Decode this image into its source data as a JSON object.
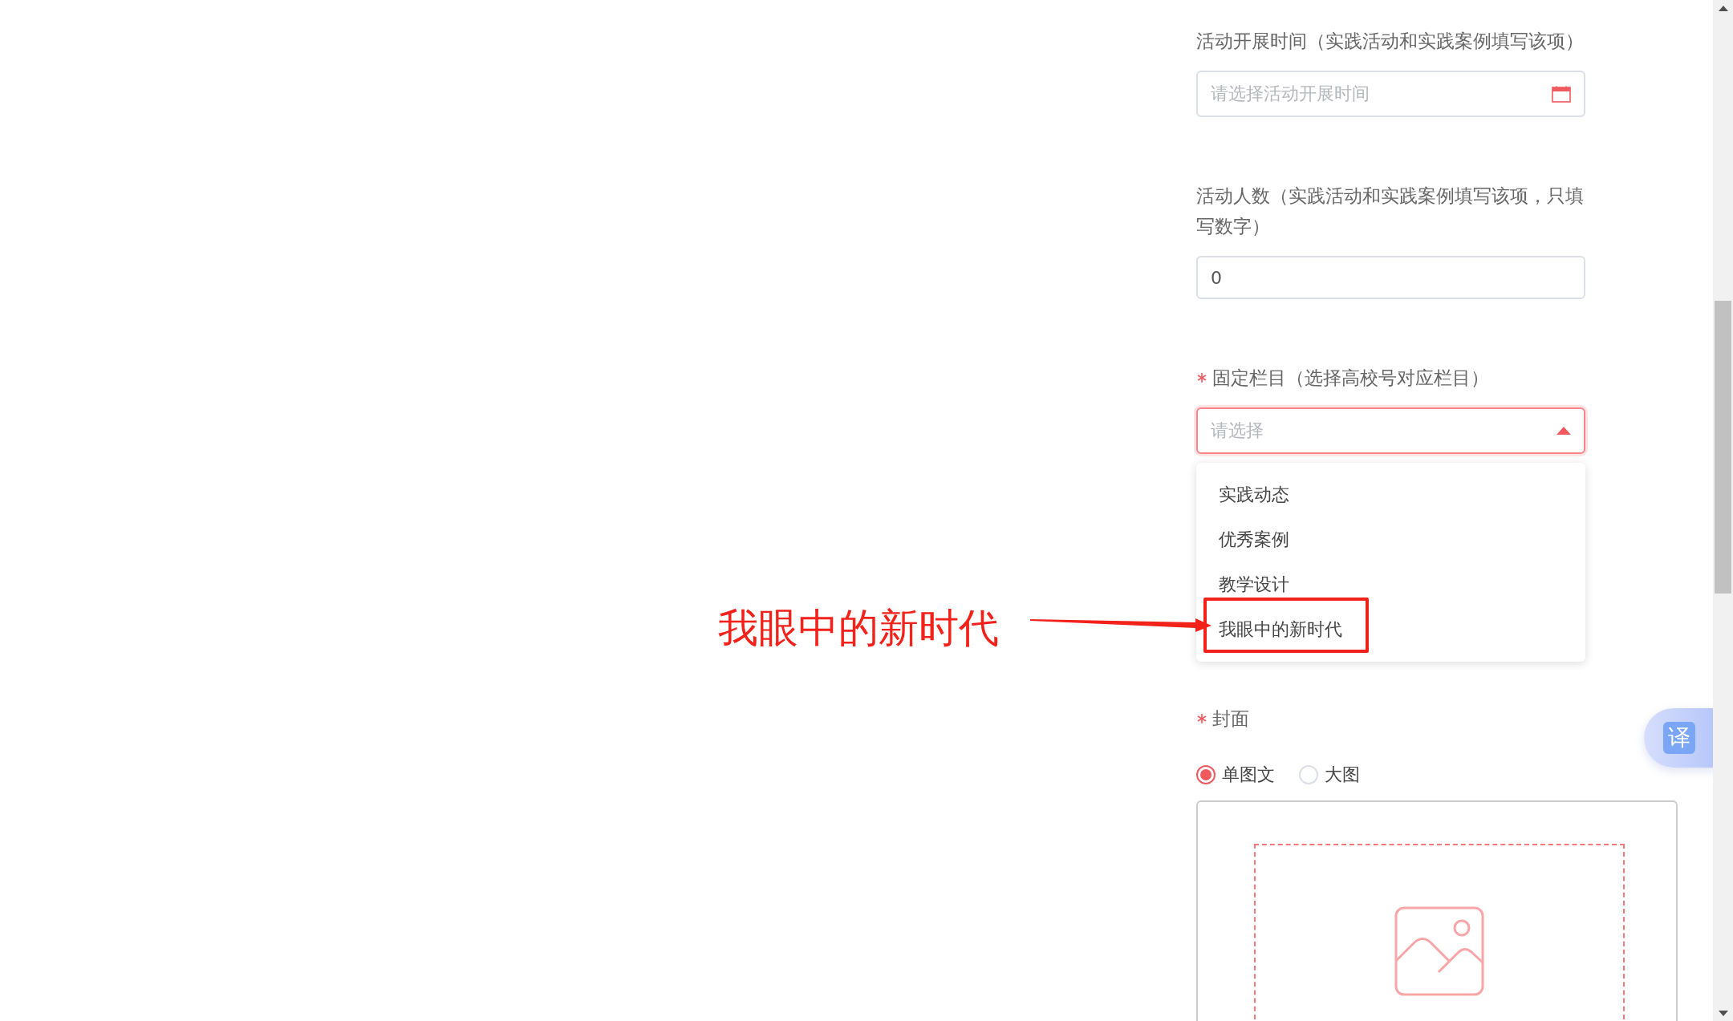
{
  "fields": [
    {
      "kind": "date",
      "label": "活动开展时间（实践活动和实践案例填写该项）",
      "required": false,
      "placeholder": "请选择活动开展时间"
    },
    {
      "kind": "number",
      "label": "活动人数（实践活动和实践案例填写该项，只填写数字）",
      "required": false,
      "value": "0"
    },
    {
      "kind": "select",
      "label": "固定栏目（选择高校号对应栏目）",
      "required": true,
      "placeholder": "请选择",
      "expanded": true,
      "options": [
        {
          "label": "实践动态",
          "selected": false
        },
        {
          "label": "优秀案例",
          "selected": false
        },
        {
          "label": "教学设计",
          "selected": false
        },
        {
          "label": "我眼中的新时代",
          "selected": false
        }
      ]
    },
    {
      "kind": "radio",
      "label": "封面",
      "required": true,
      "options": [
        {
          "label": "单图文",
          "selected": true
        },
        {
          "label": "大图",
          "selected": false
        }
      ]
    }
  ],
  "annotation": {
    "text": "我眼中的新时代"
  },
  "translate_button": {
    "label": "译"
  }
}
